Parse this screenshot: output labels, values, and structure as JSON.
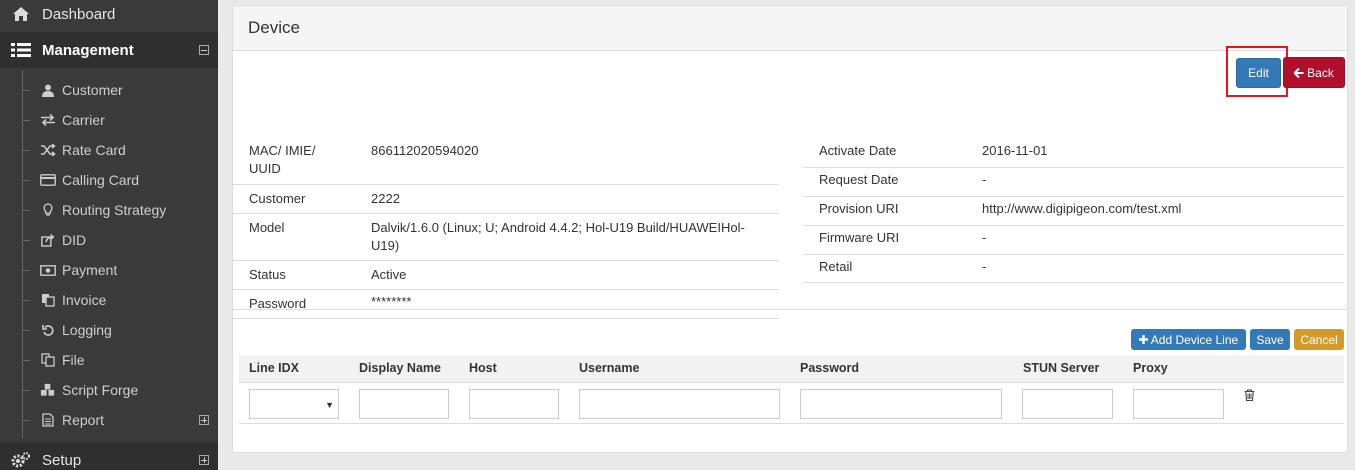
{
  "sidebar": {
    "dashboard": "Dashboard",
    "management": "Management",
    "items": [
      {
        "label": "Customer",
        "icon": "user-icon"
      },
      {
        "label": "Carrier",
        "icon": "exchange-icon"
      },
      {
        "label": "Rate Card",
        "icon": "random-icon"
      },
      {
        "label": "Calling Card",
        "icon": "credit-card-icon"
      },
      {
        "label": "Routing Strategy",
        "icon": "lightbulb-icon"
      },
      {
        "label": "DID",
        "icon": "share-icon"
      },
      {
        "label": "Payment",
        "icon": "money-icon"
      },
      {
        "label": "Invoice",
        "icon": "copy-icon"
      },
      {
        "label": "Logging",
        "icon": "undo-icon"
      },
      {
        "label": "File",
        "icon": "files-icon"
      },
      {
        "label": "Script Forge",
        "icon": "cubes-icon"
      },
      {
        "label": "Report",
        "icon": "file-text-icon"
      }
    ],
    "setup": "Setup"
  },
  "panel": {
    "title": "Device",
    "edit_label": "Edit",
    "back_label": "Back"
  },
  "left_fields": [
    {
      "key": "MAC/ IMIE/ UUID",
      "value": "866112020594020"
    },
    {
      "key": "Customer",
      "value": "2222"
    },
    {
      "key": "Model",
      "value": "Dalvik/1.6.0 (Linux; U; Android 4.4.2; Hol-U19 Build/HUAWEIHol-U19)"
    },
    {
      "key": "Status",
      "value": "Active"
    },
    {
      "key": "Password",
      "value": "********"
    }
  ],
  "right_fields": [
    {
      "key": "Activate Date",
      "value": "2016-11-01"
    },
    {
      "key": "Request Date",
      "value": "-"
    },
    {
      "key": "Provision URI",
      "value": "http://www.digipigeon.com/test.xml"
    },
    {
      "key": "Firmware URI",
      "value": "-"
    },
    {
      "key": "Retail",
      "value": "-"
    }
  ],
  "lines": {
    "add_label": "Add Device Line",
    "save_label": "Save",
    "cancel_label": "Cancel",
    "columns": [
      "Line IDX",
      "Display Name",
      "Host",
      "Username",
      "Password",
      "STUN Server",
      "Proxy"
    ],
    "row": {
      "line_idx": "",
      "display_name": "",
      "host": "",
      "username": "",
      "password": "",
      "stun_server": "",
      "proxy": ""
    }
  },
  "colors": {
    "primary": "#337ab7",
    "danger": "#b0102b",
    "warning": "#d39a2a",
    "highlight": "#e3161b",
    "sidebar": "#3a3a3a"
  }
}
